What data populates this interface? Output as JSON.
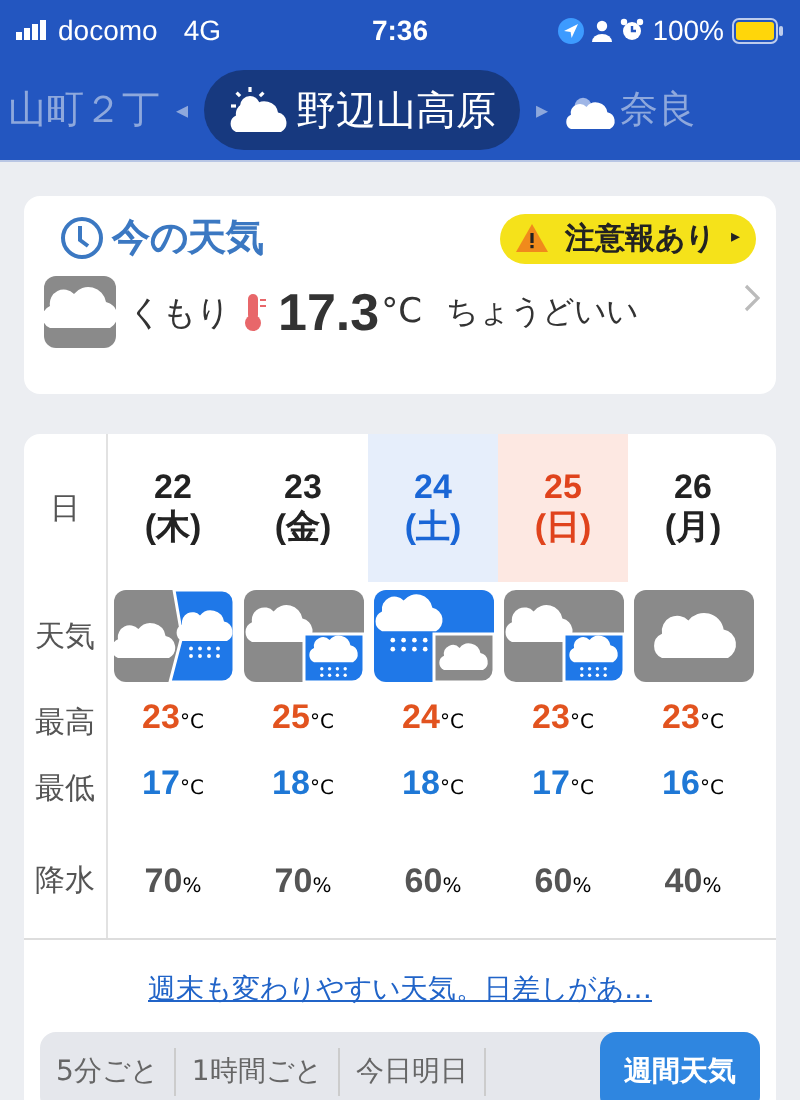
{
  "status_bar": {
    "carrier": "docomo",
    "network": "4G",
    "time": "7:36",
    "battery": "100%"
  },
  "locations": {
    "previous": "山町２丁",
    "prev_arrow": "◂",
    "current": "野辺山高原",
    "next_arrow": "▸",
    "next": "奈良"
  },
  "current_weather": {
    "title": "今の天気",
    "alert": "注意報あり",
    "alert_arrow": "▸",
    "condition": "くもり",
    "temperature": "17.3",
    "unit": "°C",
    "comment": "ちょうどいい"
  },
  "weekly": {
    "labels": {
      "date": "日",
      "weather": "天気",
      "high": "最高",
      "low": "最低",
      "precip": "降水"
    },
    "days": [
      {
        "kind": "weekday",
        "date": "22",
        "weekday": "(木)",
        "weather": {
          "kind": "then",
          "parts": [
            {
              "kind": "cloudy"
            },
            {
              "kind": "rain"
            }
          ]
        },
        "high": "23",
        "high_unit": "°C",
        "low": "17",
        "low_unit": "°C",
        "precip": "70",
        "precip_unit": "%"
      },
      {
        "kind": "weekday",
        "date": "23",
        "weekday": "(金)",
        "weather": {
          "kind": "sometimes",
          "parts": [
            {
              "kind": "cloudy"
            },
            {
              "kind": "rain"
            }
          ]
        },
        "high": "25",
        "high_unit": "°C",
        "low": "18",
        "low_unit": "°C",
        "precip": "70",
        "precip_unit": "%"
      },
      {
        "kind": "saturday",
        "date": "24",
        "weekday": "(土)",
        "weather": {
          "kind": "sometimes",
          "parts": [
            {
              "kind": "rain"
            },
            {
              "kind": "cloudy"
            }
          ]
        },
        "high": "24",
        "high_unit": "°C",
        "low": "18",
        "low_unit": "°C",
        "precip": "60",
        "precip_unit": "%"
      },
      {
        "kind": "sunday",
        "date": "25",
        "weekday": "(日)",
        "weather": {
          "kind": "sometimes",
          "parts": [
            {
              "kind": "cloudy"
            },
            {
              "kind": "rain"
            }
          ]
        },
        "high": "23",
        "high_unit": "°C",
        "low": "17",
        "low_unit": "°C",
        "precip": "60",
        "precip_unit": "%"
      },
      {
        "kind": "weekday",
        "date": "26",
        "weekday": "(月)",
        "weather": {
          "kind": "single",
          "parts": [
            {
              "kind": "cloudy"
            }
          ]
        },
        "high": "23",
        "high_unit": "°C",
        "low": "16",
        "low_unit": "°C",
        "precip": "40",
        "precip_unit": "%"
      }
    ],
    "headline": "週末も変わりやすい天気。日差しがあ…"
  },
  "tabs": [
    {
      "label": "5分ごと",
      "selected": false
    },
    {
      "label": "1時間ごと",
      "selected": false
    },
    {
      "label": "今日明日",
      "selected": false
    },
    {
      "label": "週間天気",
      "selected": true
    }
  ]
}
